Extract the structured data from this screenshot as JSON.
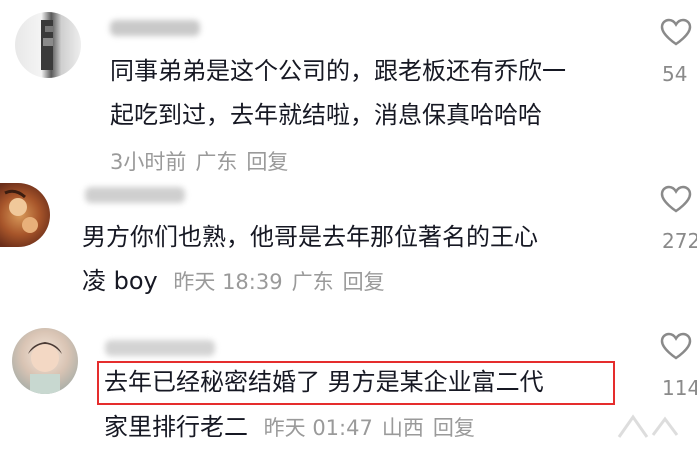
{
  "comments": [
    {
      "text_line1": "同事弟弟是这个公司的，跟老板还有乔欣一",
      "text_line2": "起吃到过，去年就结啦，消息保真哈哈哈",
      "time": "3小时前",
      "location": "广东",
      "reply_label": "回复",
      "like_count": "54"
    },
    {
      "text_line1": "男方你们也熟，他哥是去年那位著名的王心",
      "text_line2": "凌 boy",
      "time": "昨天 18:39",
      "location": "广东",
      "reply_label": "回复",
      "like_count": "272"
    },
    {
      "text_line1": "去年已经秘密结婚了 男方是某企业富二代",
      "text_line2": "家里排行老二",
      "time": "昨天 01:47",
      "location": "山西",
      "reply_label": "回复",
      "like_count": "114"
    }
  ],
  "colors": {
    "highlight_box": "#e52d2d",
    "text": "#161823",
    "meta": "#9a9a9a"
  },
  "icons": {
    "like": "heart-outline-icon"
  }
}
